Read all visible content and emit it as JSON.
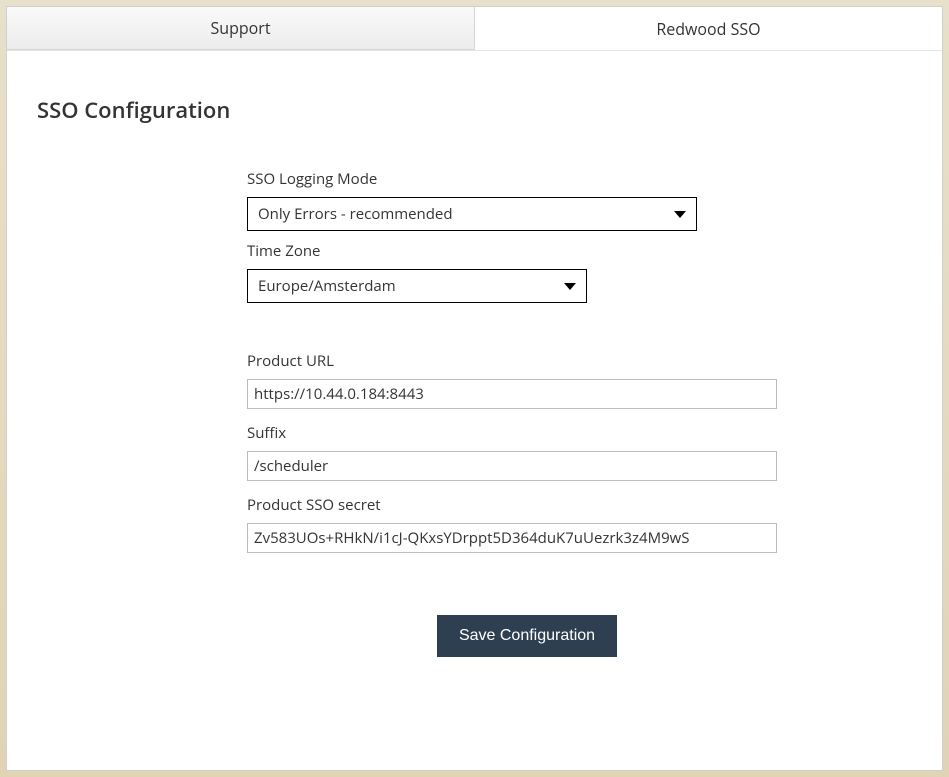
{
  "tabs": {
    "support": "Support",
    "redwood_sso": "Redwood SSO"
  },
  "page": {
    "title": "SSO Configuration"
  },
  "form": {
    "logging_mode": {
      "label": "SSO Logging Mode",
      "value": "Only Errors - recommended"
    },
    "time_zone": {
      "label": "Time Zone",
      "value": "Europe/Amsterdam"
    },
    "product_url": {
      "label": "Product URL",
      "value": "https://10.44.0.184:8443"
    },
    "suffix": {
      "label": "Suffix",
      "value": "/scheduler"
    },
    "sso_secret": {
      "label": "Product SSO secret",
      "value": "Zv583UOs+RHkN/i1cJ-QKxsYDrppt5D364duK7uUezrk3z4M9wS"
    }
  },
  "actions": {
    "save": "Save Configuration"
  }
}
